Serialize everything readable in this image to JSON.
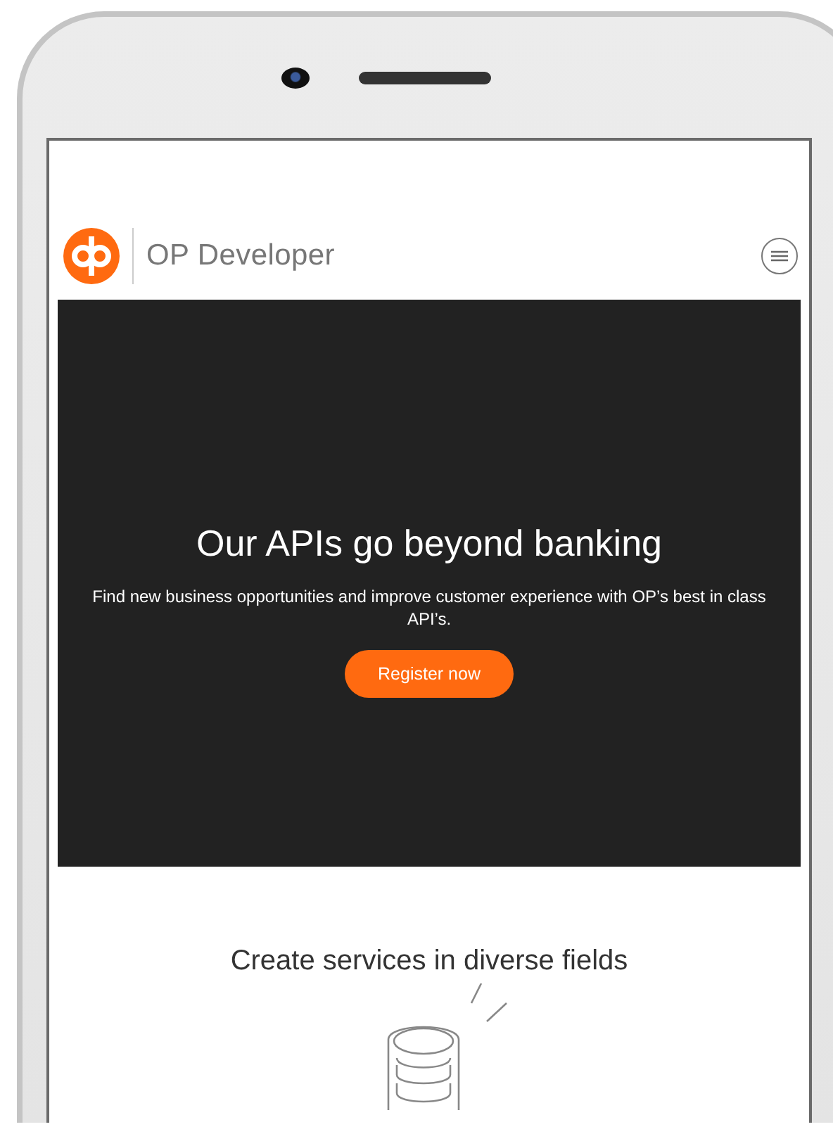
{
  "header": {
    "brand": "OP Developer"
  },
  "hero": {
    "title": "Our APIs go beyond banking",
    "text": "Find new business opportunities and improve customer experience with OP’s best in class API’s.",
    "button": "Register now"
  },
  "section": {
    "title": "Create services in diverse fields"
  }
}
